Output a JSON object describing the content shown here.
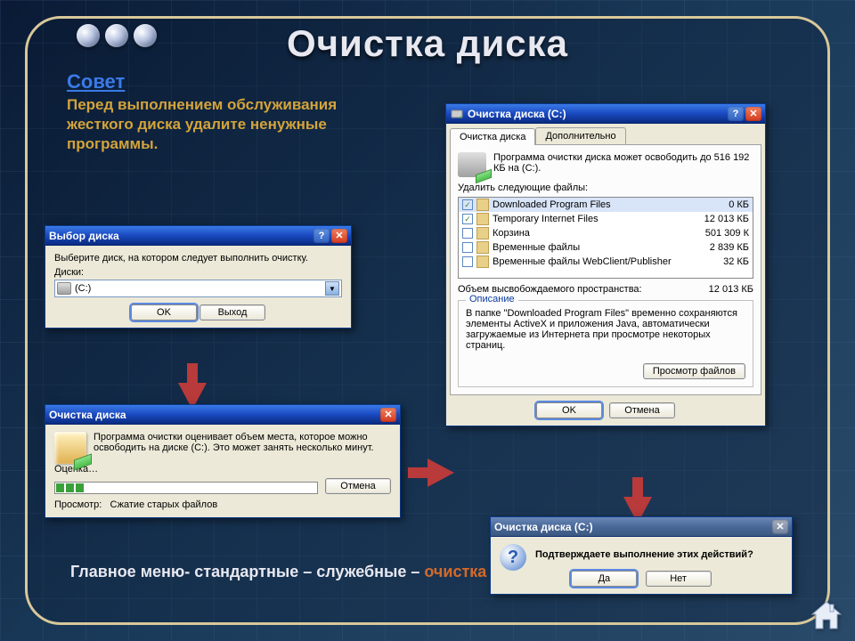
{
  "slide": {
    "title": "Очистка диска",
    "tip_heading": "Совет",
    "tip_text": "Перед выполнением обслуживания жесткого диска удалите ненужные программы.",
    "path_prefix": "Главное меню- стандартные – служебные – ",
    "path_accent": "очистка диска"
  },
  "win1": {
    "title": "Выбор диска",
    "prompt": "Выберите диск, на котором следует выполнить очистку.",
    "drives_label": "Диски:",
    "selected_drive": "(C:)",
    "ok": "OK",
    "exit": "Выход"
  },
  "win2": {
    "title": "Очистка диска",
    "message": "Программа очистки оценивает объем места, которое можно освободить на диске  (C:). Это может занять несколько минут.",
    "progress_label": "Оценка…",
    "scan_label": "Просмотр:",
    "scan_value": "Сжатие старых файлов",
    "cancel": "Отмена"
  },
  "win3": {
    "title": "Очистка диска  (C:)",
    "tab1": "Очистка диска",
    "tab2": "Дополнительно",
    "intro": "Программа очистки диска может освободить до 516 192 КБ на (C:).",
    "list_label": "Удалить следующие файлы:",
    "rows": [
      {
        "checked": true,
        "name": "Downloaded Program Files",
        "size": "0 КБ",
        "sel": true
      },
      {
        "checked": true,
        "name": "Temporary Internet Files",
        "size": "12 013 КБ"
      },
      {
        "checked": false,
        "name": "Корзина",
        "size": "501 309 К"
      },
      {
        "checked": false,
        "name": "Временные файлы",
        "size": "2 839 КБ"
      },
      {
        "checked": false,
        "name": "Временные файлы WebClient/Publisher",
        "size": "32 КБ"
      }
    ],
    "freed_label": "Объем высвобождаемого пространства:",
    "freed_value": "12 013 КБ",
    "desc_title": "Описание",
    "desc_text": "В папке \"Downloaded Program Files\" временно сохраняются элементы ActiveX и приложения Java, автоматически загружаемые из Интернета при просмотре некоторых страниц.",
    "view_files": "Просмотр файлов",
    "ok": "OK",
    "cancel": "Отмена"
  },
  "win4": {
    "title": "Очистка диска  (C:)",
    "message": "Подтверждаете выполнение этих действий?",
    "yes": "Да",
    "no": "Нет"
  }
}
